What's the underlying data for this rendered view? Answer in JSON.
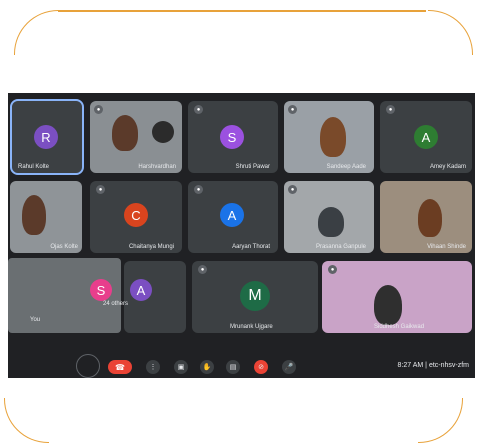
{
  "participants": [
    {
      "name": "Rahul Kolte",
      "initial": "R",
      "color": "#7b4fc2"
    },
    {
      "name": "Harshvardhan",
      "initial": "",
      "color": ""
    },
    {
      "name": "Shruti Pawar",
      "initial": "S",
      "color": "#9b51e0"
    },
    {
      "name": "Sandeep Aade",
      "initial": "",
      "color": ""
    },
    {
      "name": "Amey Kadam",
      "initial": "A",
      "color": "#2e7d32"
    },
    {
      "name": "Ojas Kolte",
      "initial": "",
      "color": ""
    },
    {
      "name": "Chaitanya Mungi",
      "initial": "C",
      "color": "#d9441e"
    },
    {
      "name": "Aaryan Thorat",
      "initial": "A",
      "color": "#1a73e8"
    },
    {
      "name": "Prasanna Ganpule",
      "initial": "",
      "color": ""
    },
    {
      "name": "Vihaan Shinde",
      "initial": "",
      "color": ""
    },
    {
      "name": "Mrunank Ujgare",
      "initial": "M",
      "color": "#1e6b46"
    },
    {
      "name": "Siddhesh Gaikwad",
      "initial": "",
      "color": ""
    }
  ],
  "self": {
    "label": "You",
    "initial": "S",
    "color": "#e83e8c"
  },
  "others": {
    "label": "24 others",
    "initial": "A"
  },
  "controls": {
    "mic": "🎤",
    "cam": "⊘",
    "captions": "▤",
    "hand": "✋",
    "present": "▣",
    "more": "⋮",
    "leave": "☎"
  },
  "meeting": {
    "time": "8:27 AM",
    "code": "etc-nhsv-zfm"
  },
  "theme": {
    "accent": "#e8a23a",
    "background": "#202124",
    "tile": "#3c4043",
    "leave": "#ea4335"
  }
}
